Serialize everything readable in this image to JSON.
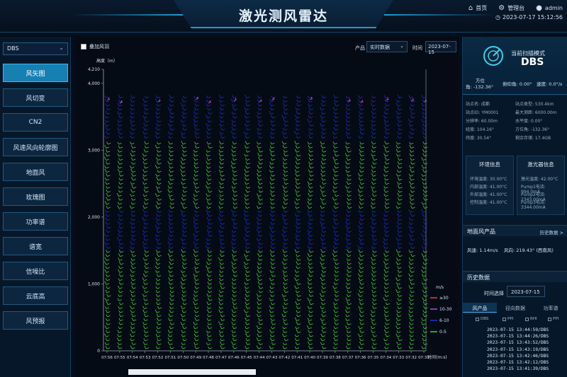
{
  "header": {
    "title": "激光测风雷达",
    "home": "首页",
    "admin_panel": "管理台",
    "user": "admin",
    "datetime": "2023-07-17 15:12:56"
  },
  "sidebar": {
    "site": "DBS",
    "items": [
      {
        "label": "风矢图",
        "active": true
      },
      {
        "label": "风切变"
      },
      {
        "label": "CN2"
      },
      {
        "label": "风速风向轮廓图"
      },
      {
        "label": "地面风"
      },
      {
        "label": "玫瑰图"
      },
      {
        "label": "功率谱"
      },
      {
        "label": "谱宽"
      },
      {
        "label": "信噪比"
      },
      {
        "label": "云底高"
      },
      {
        "label": "风预报"
      }
    ]
  },
  "toolbar": {
    "overlay_label": "叠加风羽",
    "product_label": "产品",
    "product_value": "实时数据",
    "time_label": "时间",
    "time_value": "2023-07-15"
  },
  "chart_data": {
    "type": "scatter",
    "ylabel": "高度（m）",
    "xlabel": "时间(m:s)",
    "ylim": [
      0,
      4210
    ],
    "yticks": [
      "0",
      "1,000",
      "2,000",
      "3,000",
      "4,000",
      "4,210"
    ],
    "x": [
      "07:56",
      "07:55",
      "07:54",
      "07:53",
      "07:52",
      "07:51",
      "07:50",
      "07:49",
      "07:48",
      "07:47",
      "07:46",
      "07:45",
      "07:44",
      "07:43",
      "07:42",
      "07:41",
      "07:40",
      "07:39",
      "07:38",
      "07:37",
      "07:36",
      "07:35",
      "07:34",
      "07:33",
      "07:32",
      "07:31"
    ],
    "legend_title": "m/s",
    "legend": [
      {
        "label": "≥30",
        "color": "#ff3b3b"
      },
      {
        "label": "10-30",
        "color": "#d23fd6"
      },
      {
        "label": "6-10",
        "color": "#1f2fd0"
      },
      {
        "label": "0-5",
        "color": "#45d13a"
      }
    ],
    "series_ranges": {
      "green_low": [
        0,
        1500
      ],
      "blue_low": [
        1500,
        2100
      ],
      "green_mid": [
        2100,
        3150
      ],
      "blue_high": [
        3150,
        3800
      ],
      "magenta_top": [
        3700,
        3800
      ]
    },
    "legend_position": "right",
    "grid": false
  },
  "scan": {
    "mode_label": "当前扫描模式",
    "mode": "DBS",
    "azimuth_label": "方位",
    "azimuth": "角: -132.36°",
    "pitch": "俯仰角: 0.00°",
    "speed": "速度: 0.0°/s"
  },
  "info": [
    [
      "站点名: 成都",
      "站点类型: 530.4km"
    ],
    [
      "站点ID: YM0001",
      "最大测距: 6000.00m"
    ],
    [
      "分辨率: 60.00m",
      "水平度: 0.00°"
    ],
    [
      "经度: 104.16°",
      "方位角: -132.36°"
    ],
    [
      "纬度: 30.54°",
      "剩余存储: 17.4GB"
    ]
  ],
  "env": {
    "title": "环境信息",
    "lines": [
      "环境温度: 30.00°C",
      "内部温度: 41.00°C",
      "外部温度: 41.00°C",
      "控制温度: 41.00°C"
    ]
  },
  "laser": {
    "title": "激光器信息",
    "lines": [
      "激光温度: 42.00°C",
      "Pump1电流: 994.0mA",
      "Pump2电流: 2343.00mA",
      "Pump3电流: 3344.00mA"
    ]
  },
  "ground": {
    "title": "地面风产品",
    "link": "历史数据 >",
    "speed": "风速: 1.14m/s",
    "direction": "风向: 219.43° (西南风)"
  },
  "history": {
    "title": "历史数据",
    "time_label": "时间选择",
    "time_value": "2023-07-15",
    "tabs": [
      "风产品",
      "径向数据",
      "功率谱"
    ],
    "filters": [
      "DBS",
      "PPI",
      "RHI",
      "PPI"
    ],
    "items": [
      "2023-07-15 13:44:59/DBS",
      "2023-07-15 13:44:26/DBS",
      "2023-07-15 13:43:52/DBS",
      "2023-07-15 13:43:19/DBS",
      "2023-07-15 13:42:46/DBS",
      "2023-07-15 13:42:12/DBS",
      "2023-07-15 13:41:39/DBS"
    ]
  },
  "colors": {
    "accent": "#1b9fd8",
    "active_menu": "#1780b3",
    "panel": "#07172a"
  }
}
